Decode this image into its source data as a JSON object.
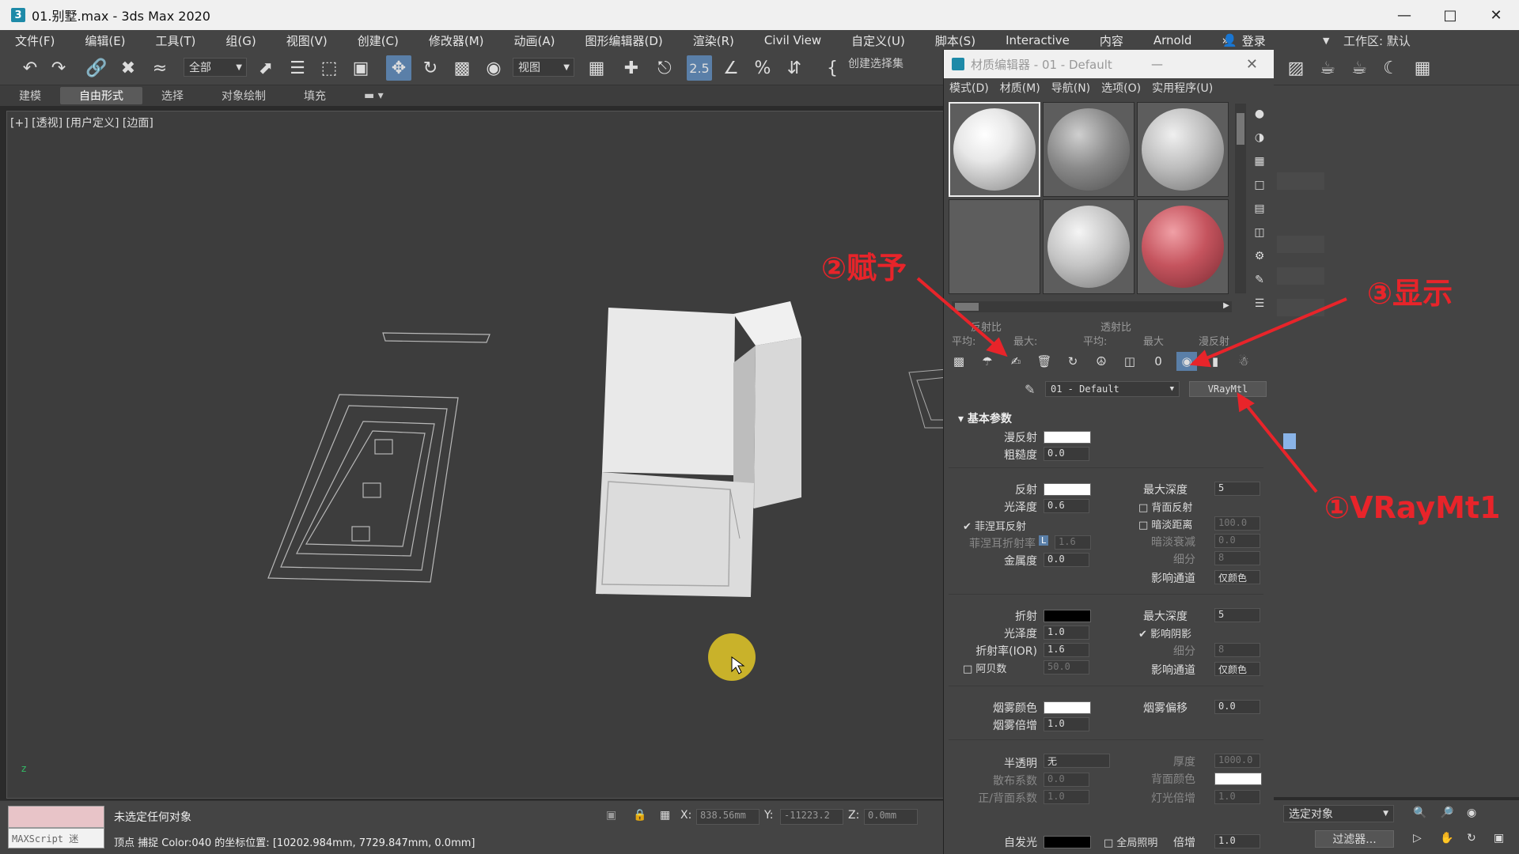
{
  "window": {
    "title": "01.别墅.max - 3ds Max 2020",
    "app_icon": "3"
  },
  "menubar": {
    "items": [
      "文件(F)",
      "编辑(E)",
      "工具(T)",
      "组(G)",
      "视图(V)",
      "创建(C)",
      "修改器(M)",
      "动画(A)",
      "图形编辑器(D)",
      "渲染(R)",
      "Civil View",
      "自定义(U)",
      "脚本(S)",
      "Interactive",
      "内容",
      "Arnold"
    ],
    "more": "»",
    "login": "登录",
    "workspace": "工作区: 默认"
  },
  "toolbar": {
    "filter_dropdown": "全部",
    "view_dropdown": "视图",
    "create_selection_set": "创建选择集",
    "snap_label": "2.5"
  },
  "ribbon": {
    "tabs": [
      "建模",
      "自由形式",
      "选择",
      "对象绘制",
      "填充"
    ],
    "active": "自由形式"
  },
  "viewport": {
    "label": "[+] [透视] [用户定义] [边面]",
    "axis_label": "z"
  },
  "material_editor": {
    "title": "材质编辑器 - 01 - Default",
    "menu": [
      "模式(D)",
      "材质(M)",
      "导航(N)",
      "选项(O)",
      "实用程序(U)"
    ],
    "stats": {
      "reflect_label": "反射比",
      "transmit_label": "透射比",
      "avg_label": "平均:",
      "max_label": "最大:",
      "avg_label2": "平均:",
      "max_label2": "最大",
      "diffuse_label": "漫反射"
    },
    "material_name": "01 - Default",
    "material_type": "VRayMtl",
    "section_basic": "基本参数",
    "diffuse": {
      "label": "漫反射",
      "color": "#ffffff"
    },
    "roughness": {
      "label": "粗糙度",
      "value": "0.0"
    },
    "reflect": {
      "label": "反射",
      "color": "#ffffff"
    },
    "gloss": {
      "label": "光泽度",
      "value": "0.6"
    },
    "fresnel": {
      "label": "菲涅耳反射",
      "checked": true
    },
    "fresnel_ior": {
      "label": "菲涅耳折射率",
      "lock": "L",
      "value": "1.6"
    },
    "metalness": {
      "label": "金属度",
      "value": "0.0"
    },
    "max_depth": {
      "label": "最大深度",
      "value": "5"
    },
    "back_reflect": {
      "label": "背面反射"
    },
    "dim_distance": {
      "label": "暗淡距离",
      "value": "100.0"
    },
    "dim_falloff": {
      "label": "暗淡衰减",
      "value": "0.0"
    },
    "subdivs": {
      "label": "细分",
      "value": "8"
    },
    "affect_channels": {
      "label": "影响通道",
      "value": "仅颜色"
    },
    "refract": {
      "label": "折射",
      "color": "#000000"
    },
    "refr_gloss": {
      "label": "光泽度",
      "value": "1.0"
    },
    "ior": {
      "label": "折射率(IOR)",
      "value": "1.6"
    },
    "abbe": {
      "label": "阿贝数",
      "value": "50.0"
    },
    "refr_max_depth": {
      "label": "最大深度",
      "value": "5"
    },
    "affect_shadows": {
      "label": "影响阴影",
      "checked": true
    },
    "refr_subdivs": {
      "label": "细分",
      "value": "8"
    },
    "refr_affect_channels": {
      "label": "影响通道",
      "value": "仅颜色"
    },
    "fog_color": {
      "label": "烟雾颜色",
      "color": "#ffffff"
    },
    "fog_mult": {
      "label": "烟雾倍增",
      "value": "1.0"
    },
    "fog_bias": {
      "label": "烟雾偏移",
      "value": "0.0"
    },
    "translucency": {
      "label": "半透明",
      "value": "无"
    },
    "thickness": {
      "label": "厚度",
      "value": "1000.0"
    },
    "scatter": {
      "label": "散布系数",
      "value": "0.0"
    },
    "back_color": {
      "label": "背面颜色"
    },
    "front_back": {
      "label": "正/背面系数",
      "value": "1.0"
    },
    "light_mult": {
      "label": "灯光倍增",
      "value": "1.0"
    },
    "self_illum": {
      "label": "自发光",
      "color": "#000000"
    },
    "gi": {
      "label": "全局照明"
    },
    "self_mult": {
      "label": "倍增",
      "value": "1.0"
    }
  },
  "annotations": {
    "assign": "②赋予",
    "show": "③显示",
    "vraymtl": "①VRayMt1"
  },
  "statusbar": {
    "listener_label": "MAXScript 迷",
    "status_line1": "未选定任何对象",
    "status_line2": "顶点 捕捉 Color:040 的坐标位置: [10202.984mm, 7729.847mm, 0.0mm]",
    "x_label": "X:",
    "x_value": "838.56mm",
    "y_label": "Y:",
    "y_value": "-11223.2",
    "z_label": "Z:",
    "z_value": "0.0mm"
  },
  "right_bottom": {
    "selection_dropdown": "选定对象",
    "filter_button": "过滤器..."
  }
}
